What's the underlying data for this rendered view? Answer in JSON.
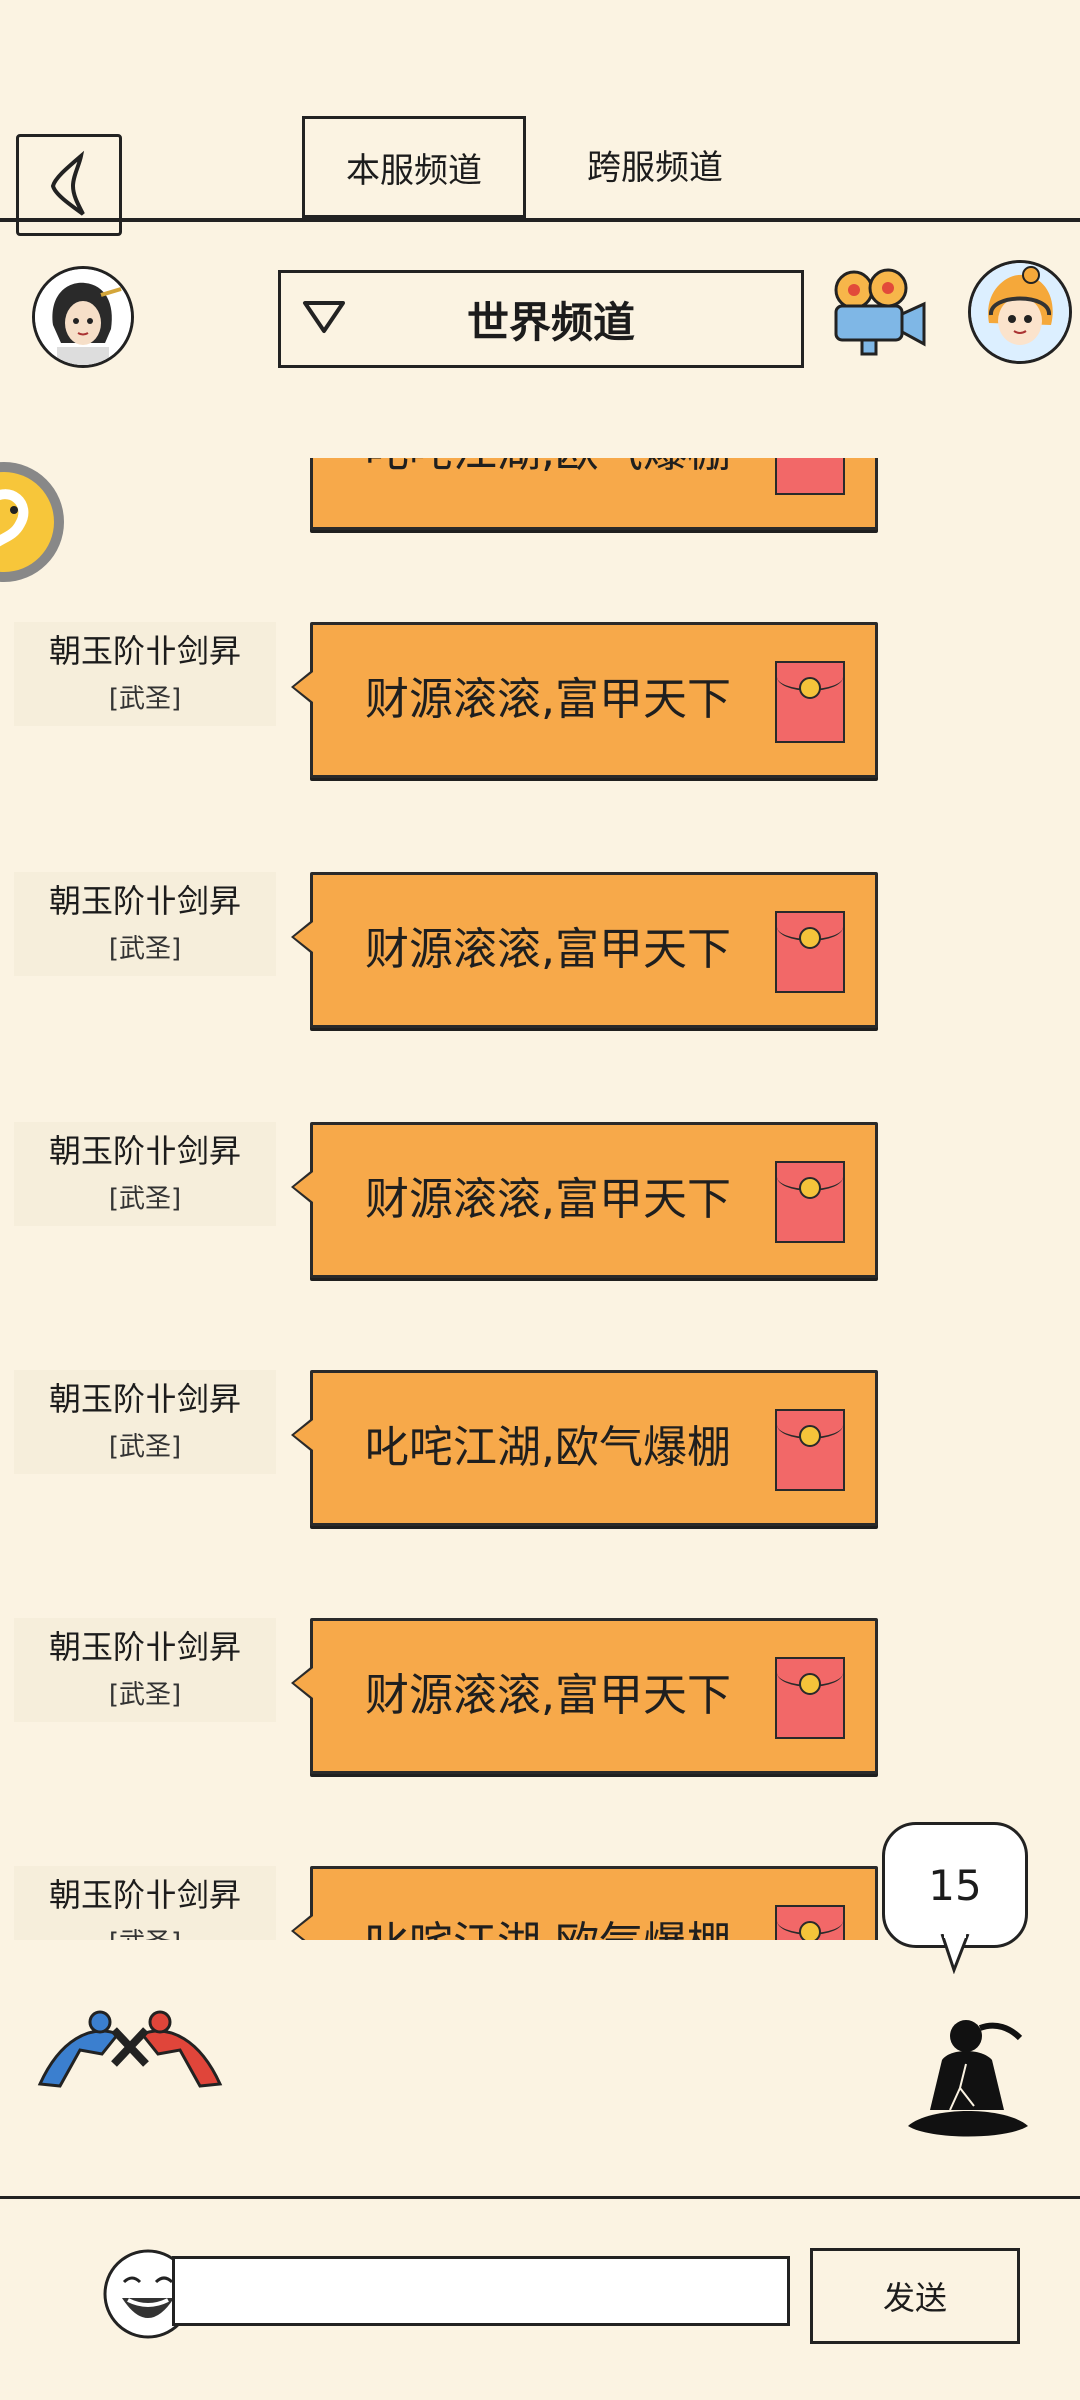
{
  "tabs": [
    {
      "label": "本服频道",
      "active": true
    },
    {
      "label": "跨服频道",
      "active": false
    }
  ],
  "channel": {
    "label": "世界频道"
  },
  "icons": {
    "back": "back-chevron-icon",
    "player_avatar": "player-avatar-icon",
    "video": "video-camera-icon",
    "support": "customer-service-avatar-icon",
    "reward": "reward-float-icon",
    "pk": "pk-fighters-icon",
    "meditate": "meditating-figure-icon",
    "emoji": "laughing-face-icon",
    "red_envelope": "red-envelope-icon"
  },
  "messages": [
    {
      "sender": "",
      "title": "",
      "text": "叱咤江湖,欧气爆棚"
    },
    {
      "sender": "朝玉阶卝剑昇",
      "title": "[武圣]",
      "text": "财源滚滚,富甲天下"
    },
    {
      "sender": "朝玉阶卝剑昇",
      "title": "[武圣]",
      "text": "财源滚滚,富甲天下"
    },
    {
      "sender": "朝玉阶卝剑昇",
      "title": "[武圣]",
      "text": "财源滚滚,富甲天下"
    },
    {
      "sender": "朝玉阶卝剑昇",
      "title": "[武圣]",
      "text": "叱咤江湖,欧气爆棚"
    },
    {
      "sender": "朝玉阶卝剑昇",
      "title": "[武圣]",
      "text": "财源滚滚,富甲天下"
    },
    {
      "sender": "朝玉阶卝剑昇",
      "title": "[武圣]",
      "text": "叱咤江湖,欧气爆棚"
    }
  ],
  "unread_count": "15",
  "input": {
    "value": "",
    "placeholder": ""
  },
  "send_label": "发送",
  "colors": {
    "background": "#fbf3e2",
    "bubble": "#f7a94a",
    "envelope": "#f26868"
  }
}
